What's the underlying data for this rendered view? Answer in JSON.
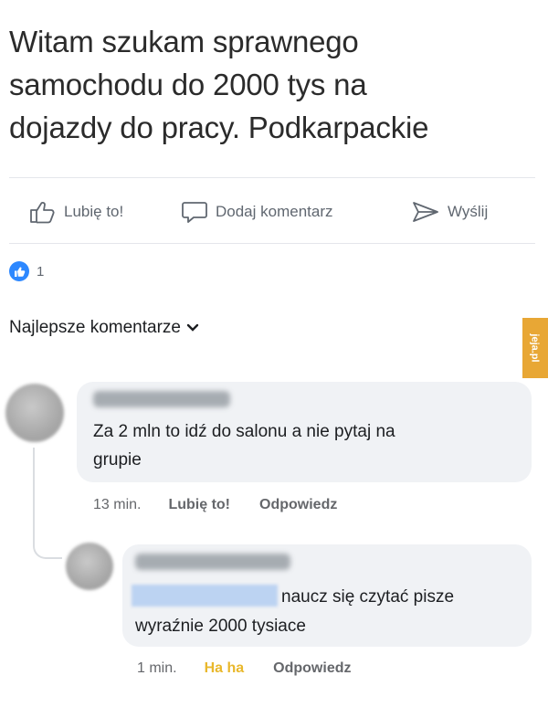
{
  "post": {
    "lines": [
      "Witam szukam sprawnego",
      "samochodu do 2000 tys na",
      "dojazdy do pracy. Podkarpackie"
    ]
  },
  "actions": {
    "like": "Lubię to!",
    "comment": "Dodaj komentarz",
    "send": "Wyślij"
  },
  "reactions": {
    "count": "1"
  },
  "comments_header": {
    "label": "Najlepsze komentarze"
  },
  "watermark": {
    "text": "jeja.pl"
  },
  "comments": [
    {
      "text": "Za 2 mln to idź do salonu a nie pytaj na grupie",
      "lines": [
        "Za 2 mln to idź do salonu a nie pytaj na",
        "grupie"
      ],
      "time": "13 min.",
      "like": "Lubię to!",
      "reply": "Odpowiedz"
    },
    {
      "lines": [
        "naucz się czytać pisze",
        "wyraźnie 2000 tysiace"
      ],
      "time": "1 min.",
      "reaction": "Ha ha",
      "reply": "Odpowiedz"
    }
  ],
  "colors": {
    "accent": "#2d88ff",
    "haha": "#e9b82c",
    "bubble": "#f0f2f5",
    "watermark": "#e8a735"
  },
  "icons": [
    "thumbs-up-icon",
    "comment-icon",
    "send-icon",
    "like-reaction-icon",
    "chevron-down-icon"
  ]
}
